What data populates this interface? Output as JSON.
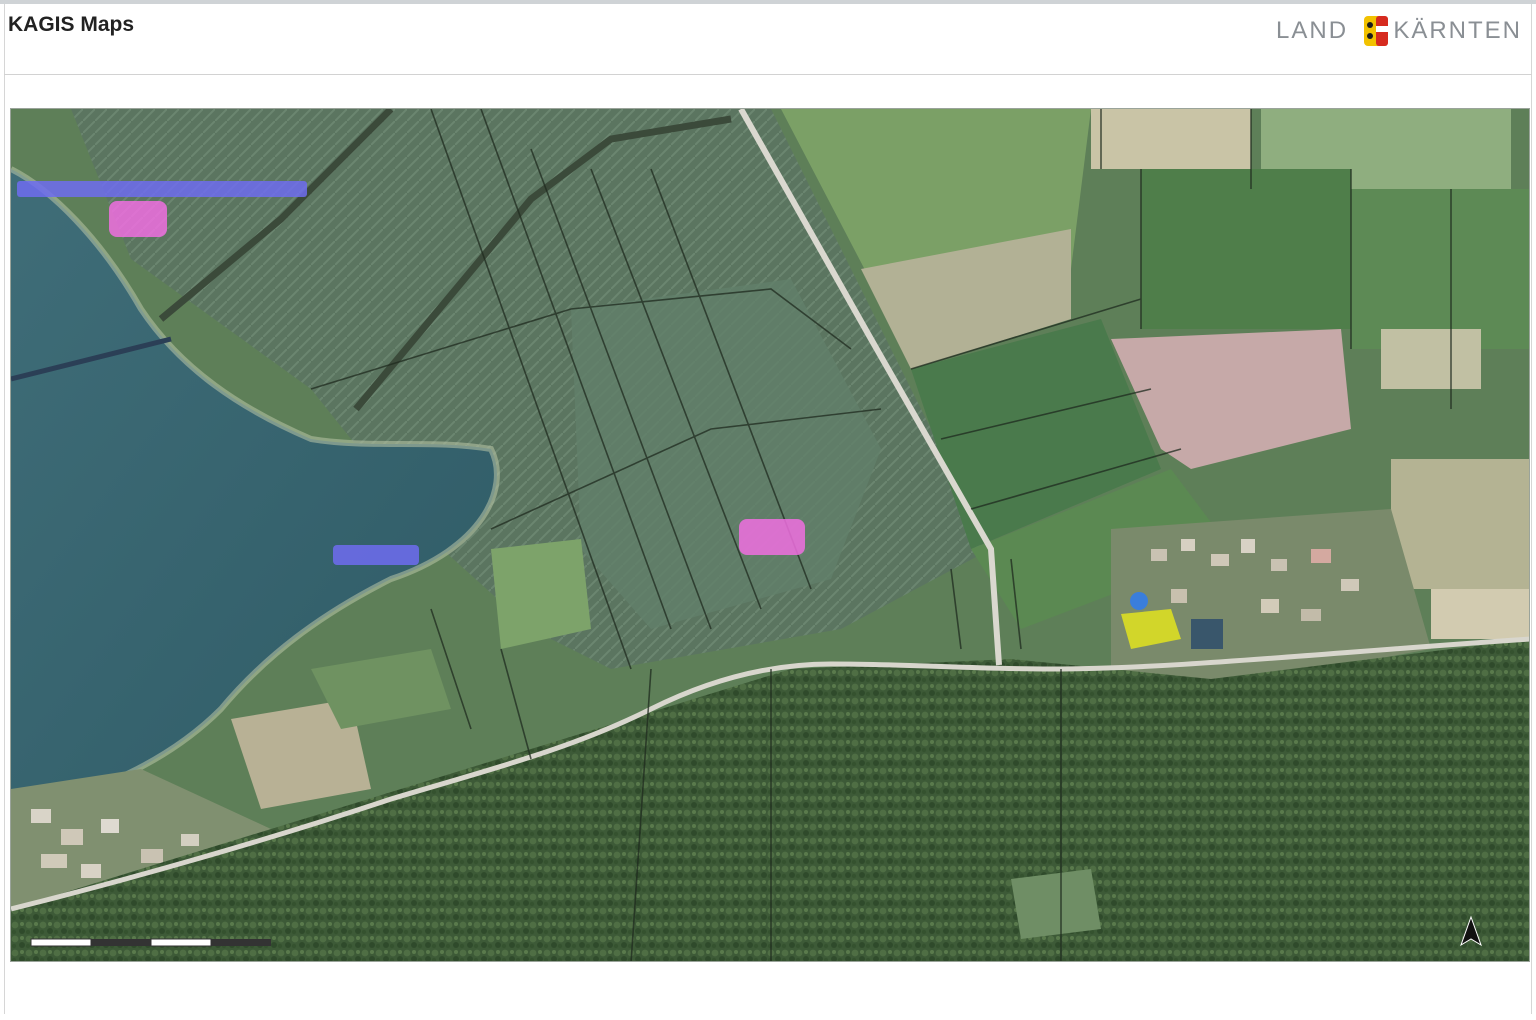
{
  "header": {
    "title": "KAGIS Maps",
    "subtitle": ""
  },
  "logo": {
    "left_text": "LAND",
    "right_text": "KÄRNTEN",
    "under_text": "",
    "colors": {
      "yellow": "#f2c200",
      "red": "#d62b1f"
    }
  },
  "infobar": {
    "created_label": "",
    "created_date": "",
    "created_time": "",
    "scale_label": "",
    "scale_value": ""
  },
  "map": {
    "basemap": "orthophoto",
    "labels": [
      {
        "name": "label-upper-left",
        "text": "",
        "color": "#6f6cf0"
      },
      {
        "name": "label-pink-northwest",
        "text": "",
        "color": "#f06ee0"
      },
      {
        "name": "label-lake",
        "text": "",
        "color": "#6f6cf0"
      },
      {
        "name": "label-pink-center",
        "text": "",
        "color": "#f06ee0"
      }
    ],
    "highlight_colors": {
      "parcel": "#e9e81a",
      "marker": "#2f7bf0"
    },
    "scalebar": {
      "text": ""
    },
    "north_arrow_icon": "north-arrow-icon"
  },
  "footer": {
    "left_lines": [
      "",
      ""
    ],
    "right_lines": [
      "",
      "",
      ""
    ]
  }
}
